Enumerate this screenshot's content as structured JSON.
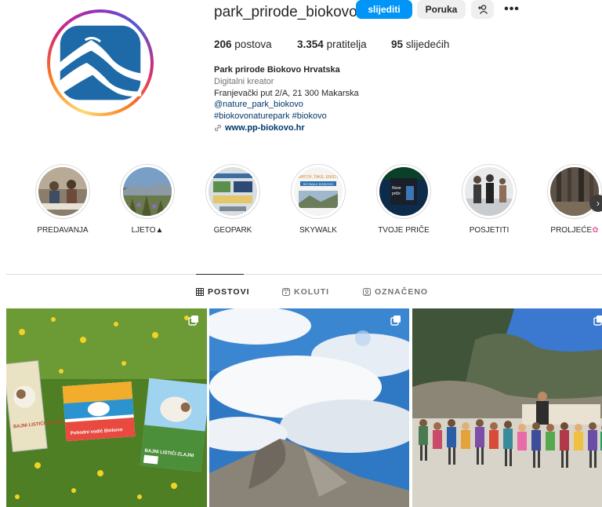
{
  "profile": {
    "username": "park_prirode_biokovo",
    "follow_label": "slijediti",
    "message_label": "Poruka",
    "more_label": "•••"
  },
  "stats": {
    "posts_count": "206",
    "posts_label": "postova",
    "followers_count": "3.354",
    "followers_label": "pratitelja",
    "following_count": "95",
    "following_label": "slijedećih"
  },
  "bio": {
    "name": "Park prirode Biokovo Hrvatska",
    "category": "Digitalni kreator",
    "address": "Franjevački put 2/A, 21 300 Makarska",
    "mention": "@nature_park_biokovo",
    "hashtags": "#biokovonaturepark #biokovo",
    "website": "www.pp-biokovo.hr"
  },
  "highlights": [
    {
      "label": "PREDAVANJA"
    },
    {
      "label": "LJETO▲"
    },
    {
      "label": "GEOPARK"
    },
    {
      "label": "SKYWALK"
    },
    {
      "label": "TVOJE PRIČE"
    },
    {
      "label": "POSJETITI"
    },
    {
      "label": "PROLJEĆE"
    }
  ],
  "highlight_texts": {
    "skywalk_1": "WATCH, TAKE, ENJOY",
    "skywalk_2": "SKYWALK BIOKOVO",
    "price_1": "Nove",
    "price_2": "priče"
  },
  "tabs": [
    {
      "label": "POSTOVI",
      "icon": "grid-icon"
    },
    {
      "label": "KOLUTI",
      "icon": "reels-icon"
    },
    {
      "label": "OZNAČENO",
      "icon": "tagged-icon"
    }
  ],
  "post_texts": {
    "book_left": "BAJNI LISTIĆI ZLAJNI",
    "book_mid": "Pohodni vodič Biokovo",
    "book_right": "BAJNI LISTIĆI ZLAJNI"
  },
  "colors": {
    "accent": "#0095f6",
    "text": "#262626",
    "muted": "#737373",
    "link": "#00376b"
  }
}
